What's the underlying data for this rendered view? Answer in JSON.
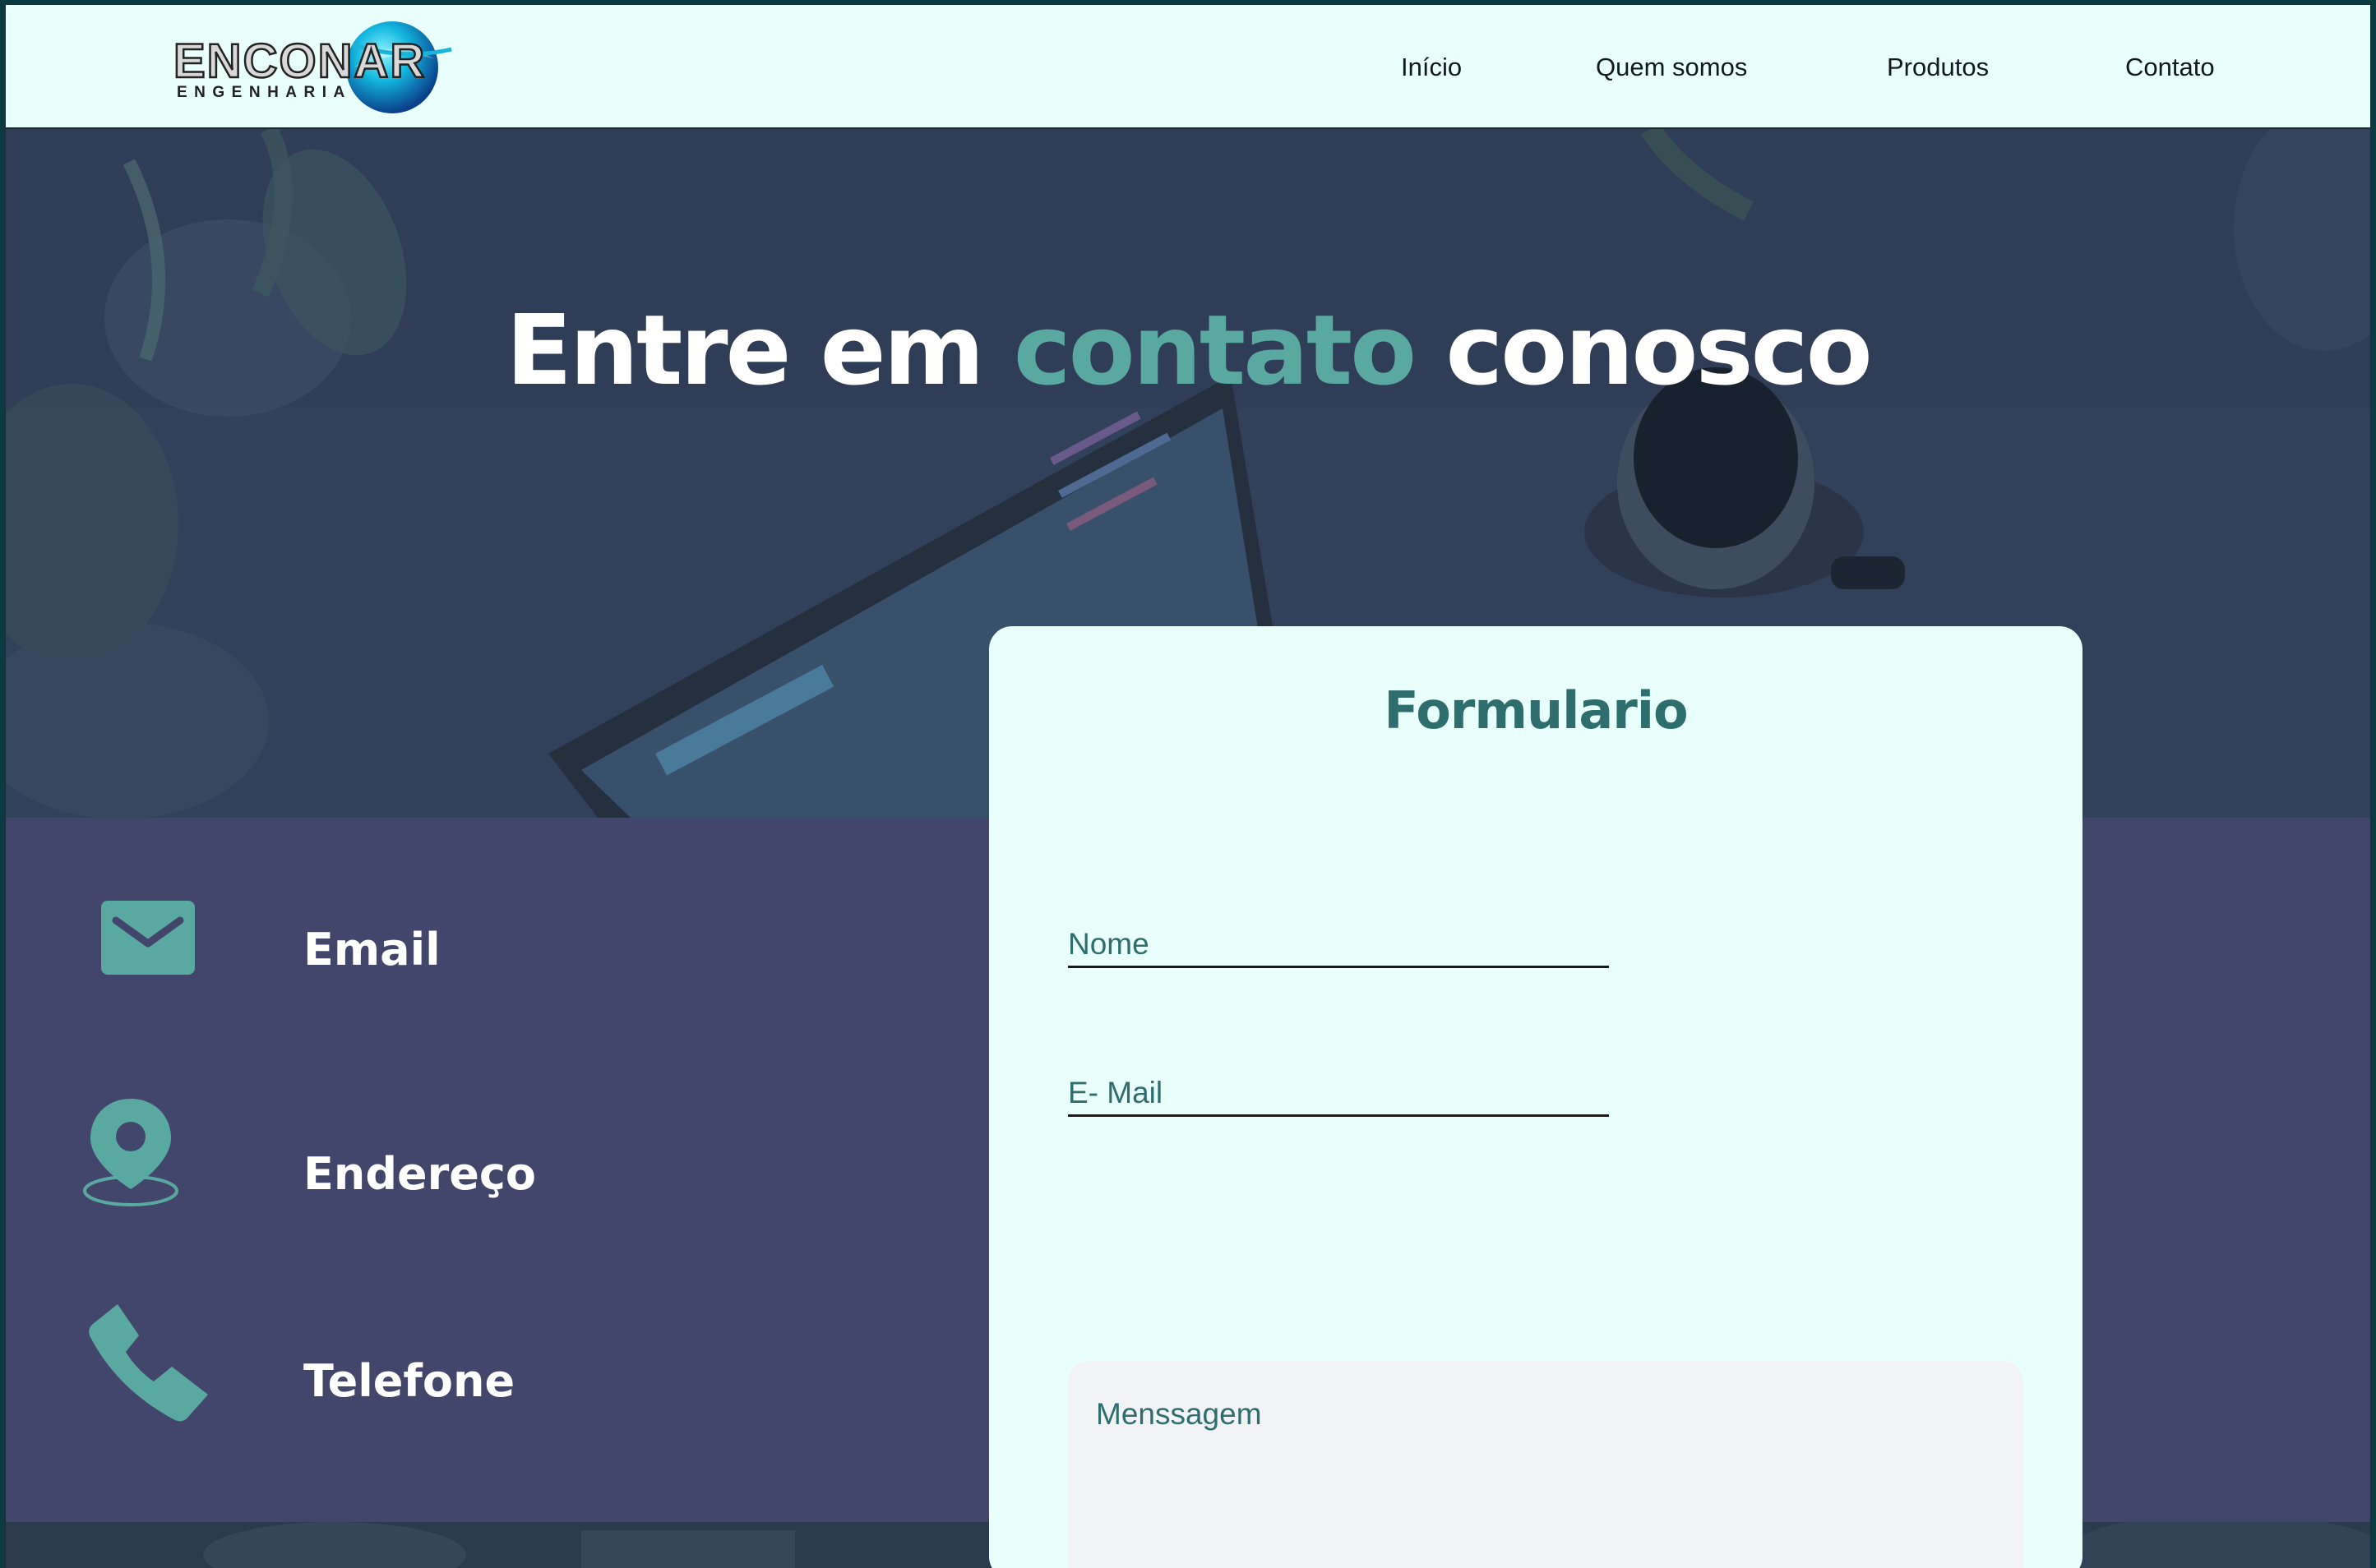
{
  "nav": {
    "logo_text": "ENCONAR",
    "logo_subtext": "ENGENHARIA",
    "links": [
      "Início",
      "Quem somos",
      "Produtos",
      "Contato"
    ]
  },
  "hero": {
    "title_part1": "Entre em ",
    "title_accent": "contato",
    "title_part2": " conosco"
  },
  "contact_info": {
    "email_label": "Email",
    "address_label": "Endereço",
    "phone_label": "Telefone"
  },
  "form": {
    "title": "Formulario",
    "name_placeholder": "Nome",
    "email_placeholder": "E- Mail",
    "message_placeholder": "Menssagem"
  },
  "colors": {
    "accent": "#5aa9a0",
    "nav_bg": "#e8fffb",
    "band_bg": "#43466b",
    "form_title": "#2f6e6e"
  }
}
